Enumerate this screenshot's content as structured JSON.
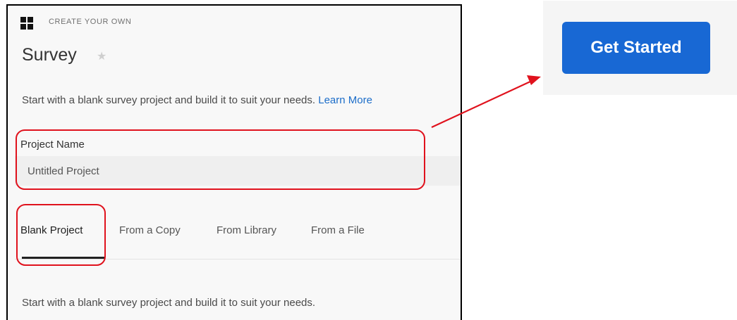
{
  "header": {
    "category_label": "CREATE YOUR OWN",
    "title": "Survey"
  },
  "description": {
    "text": "Start with a blank survey project and build it to suit your needs.",
    "learn_more_label": "Learn More"
  },
  "project_name": {
    "label": "Project Name",
    "value": "Untitled Project"
  },
  "tabs": [
    {
      "label": "Blank Project",
      "selected": true
    },
    {
      "label": "From a Copy",
      "selected": false
    },
    {
      "label": "From Library",
      "selected": false
    },
    {
      "label": "From a File",
      "selected": false
    }
  ],
  "tab_content": {
    "description": "Start with a blank survey project and build it to suit your needs."
  },
  "actions": {
    "get_started_label": "Get Started"
  },
  "icons": {
    "logo": "qualtrics-logo-icon",
    "star": "star-icon"
  },
  "colors": {
    "accent_blue": "#1868d4",
    "link_blue": "#1c6dc9",
    "highlight_red": "#e0121d"
  }
}
